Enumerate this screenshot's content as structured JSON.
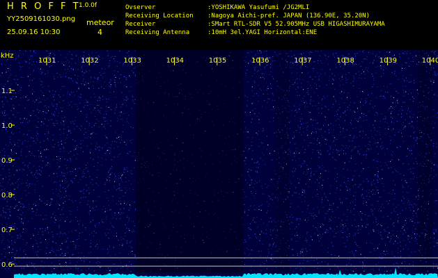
{
  "header": {
    "app_name": "H R O F F T",
    "version": "1.0.0f",
    "filename": "YY2509161030.png",
    "datetime": "25.09.16 10:30",
    "meteor_label": "meteor",
    "meteor_count": "4",
    "info": [
      {
        "label": "Ovserver",
        "value": ":YOSHIKAWA Yasufumi /JG2MLI"
      },
      {
        "label": "Receiving Location",
        "value": ":Nagoya Aichi-pref. JAPAN (136.90E, 35.20N)"
      },
      {
        "label": "Receiver",
        "value": ":SMart RTL-SDR V5 52.905MHz USB HIGASHIMURAYAMA"
      },
      {
        "label": "Receiving Antenna",
        "value": ":10mH 3el.YAGI Horizontal:ENE"
      }
    ]
  },
  "chart_data": {
    "type": "heatmap",
    "xlabel": "kHz",
    "x_ticks": [
      "1031",
      "1032",
      "1033",
      "1034",
      "1035",
      "1036",
      "1037",
      "1038",
      "1039",
      "1040"
    ],
    "y_ticks": [
      "1.1",
      "1.0",
      "0.9",
      "0.8",
      "0.7",
      "0.6"
    ],
    "colors": {
      "background": "#00003a",
      "noise": "#3a5cff",
      "spectrum": "#00e5ff",
      "text": "#ffff00",
      "reference_line": "#c8c8c8"
    }
  }
}
